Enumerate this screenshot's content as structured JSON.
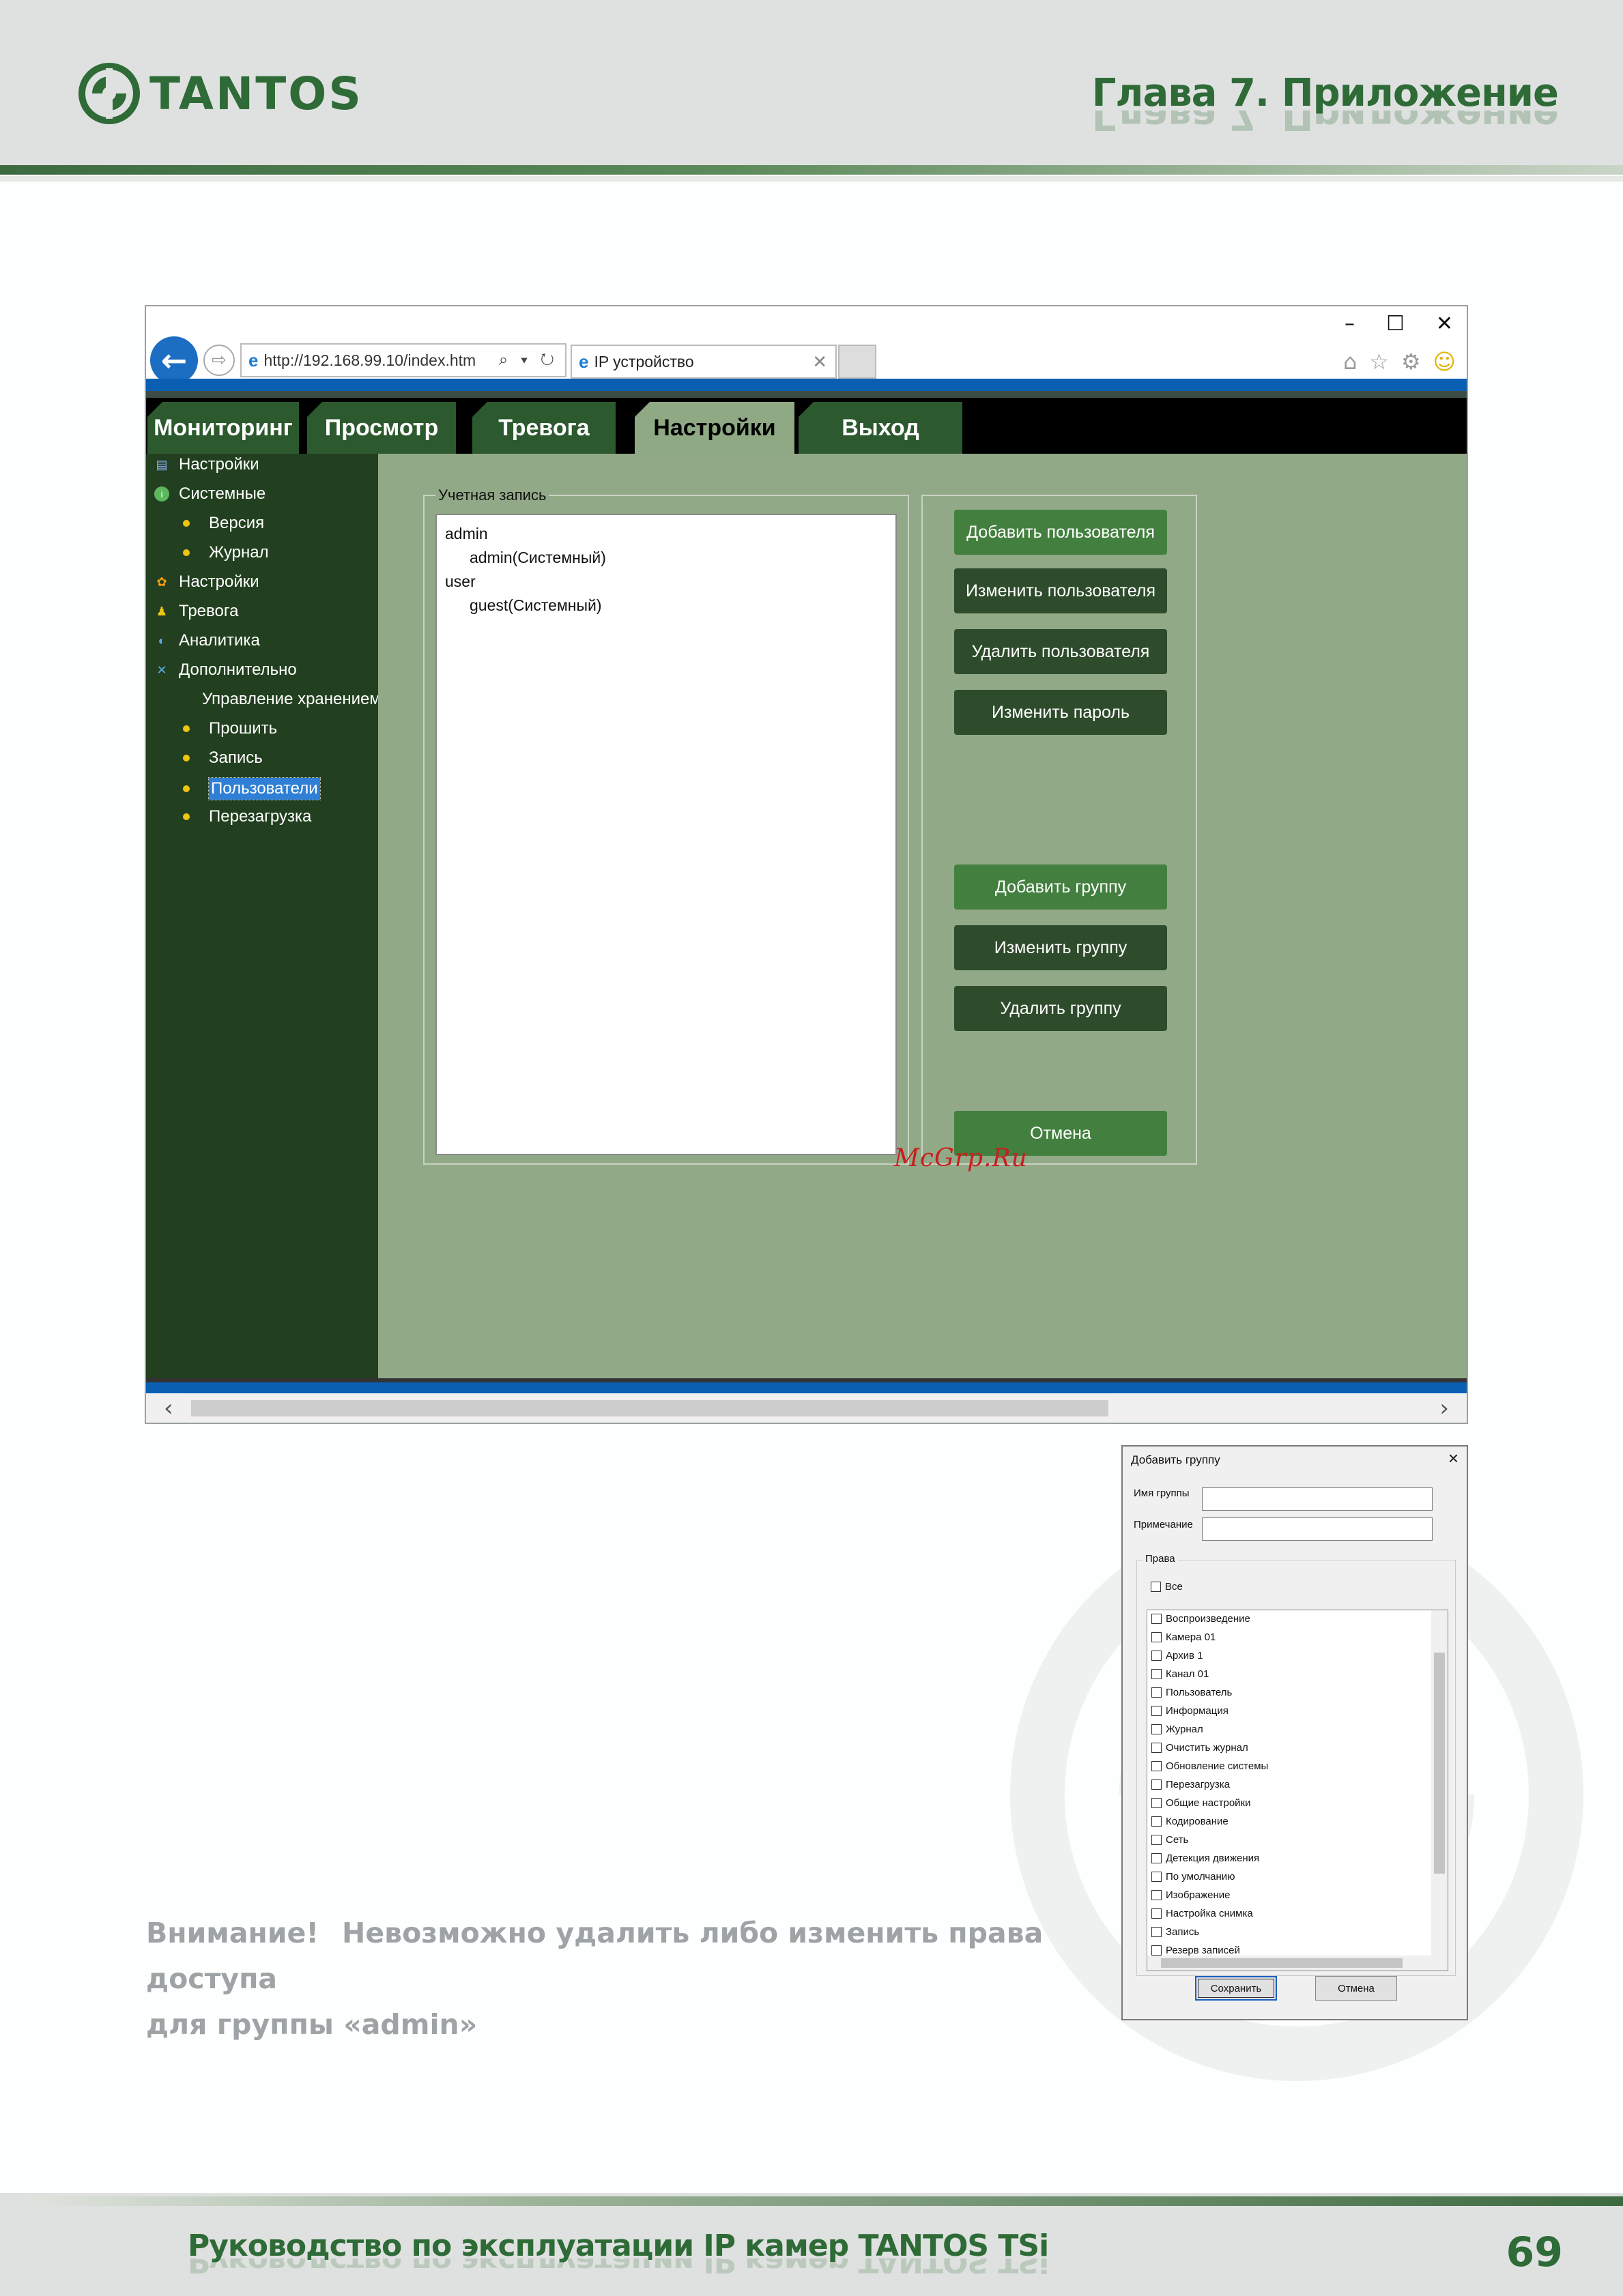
{
  "header": {
    "logo_text": "TANTOS",
    "chapter_title": "Глава 7. Приложение"
  },
  "browser": {
    "url": "http://192.168.99.10/index.htm",
    "address_tools": "⌕ ▾ ↻",
    "tab_title": "IP устройство",
    "window_controls": [
      "–",
      "☐",
      "✕"
    ],
    "menu_tabs": [
      {
        "label": "Мониторинг",
        "active": false
      },
      {
        "label": "Просмотр",
        "active": false
      },
      {
        "label": "Тревога",
        "active": false
      },
      {
        "label": "Настройки",
        "active": true
      },
      {
        "label": "Выход",
        "active": false
      }
    ],
    "sidebar": [
      {
        "label": "Настройки",
        "icon": "settings-icon",
        "level": 0
      },
      {
        "label": "Системные",
        "icon": "info-icon",
        "level": 0
      },
      {
        "label": "Версия",
        "level": 1
      },
      {
        "label": "Журнал",
        "level": 1
      },
      {
        "label": "Настройки",
        "icon": "gear-icon",
        "level": 0
      },
      {
        "label": "Тревога",
        "icon": "bell-icon",
        "level": 0
      },
      {
        "label": "Аналитика",
        "icon": "analytics-icon",
        "level": 0
      },
      {
        "label": "Дополнительно",
        "icon": "tools-icon",
        "level": 0
      },
      {
        "label": "Управление хранением",
        "level": 1
      },
      {
        "label": "Прошить",
        "level": 1
      },
      {
        "label": "Запись",
        "level": 1
      },
      {
        "label": "Пользователи",
        "level": 1,
        "selected": true
      },
      {
        "label": "Перезагрузка",
        "level": 1
      }
    ],
    "account": {
      "legend": "Учетная запись",
      "tree": [
        {
          "label": "admin",
          "child": false
        },
        {
          "label": "admin(Системный)",
          "child": true
        },
        {
          "label": "user",
          "child": false
        },
        {
          "label": "guest(Системный)",
          "child": true
        }
      ]
    },
    "buttons": {
      "add_user": "Добавить пользователя",
      "edit_user": "Изменить пользователя",
      "delete_user": "Удалить пользователя",
      "change_password": "Изменить пароль",
      "add_group": "Добавить группу",
      "edit_group": "Изменить группу",
      "delete_group": "Удалить группу",
      "cancel": "Отмена"
    },
    "watermark": "McGrp.Ru"
  },
  "dialog": {
    "title": "Добавить группу",
    "group_name_label": "Имя группы",
    "note_label": "Примечание",
    "rights_legend": "Права",
    "all_label": "Все",
    "rights": [
      "Воспроизведение",
      "Камера 01",
      "Архив 1",
      "Канал 01",
      "Пользователь",
      "Информация",
      "Журнал",
      "Очистить журнал",
      "Обновление системы",
      "Перезагрузка",
      "Общие настройки",
      "Кодирование",
      "Сеть",
      "Детекция движения",
      "По умолчанию",
      "Изображение",
      "Настройка снимка",
      "Запись",
      "Резерв записей"
    ],
    "save": "Сохранить",
    "cancel": "Отмена"
  },
  "notice": {
    "title": "Внимание!",
    "line1": "Невозможно удалить либо изменить права доступа",
    "line2": "для группы «admin»"
  },
  "footer": {
    "title": "Руководство по эксплуатации IP камер TANTOS TSi",
    "page_number": "69"
  },
  "colors": {
    "brand_green": "#2e6b37",
    "menu_green": "#2c5a2e",
    "content_bg": "#92a987",
    "sidebar_bg": "#22401f",
    "selection_blue": "#2f7fd6"
  }
}
